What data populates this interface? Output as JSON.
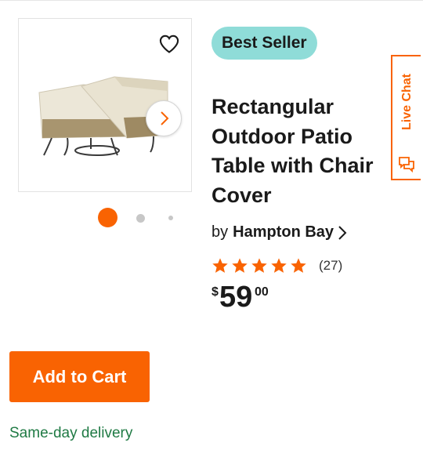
{
  "product": {
    "badge": "Best Seller",
    "title_lines": [
      "Rectangular",
      "Outdoor Patio",
      "Table with Chair",
      "Cover"
    ],
    "brand_prefix": "by",
    "brand": "Hampton Bay",
    "rating": 5,
    "review_count": "(27)",
    "price": {
      "currency": "$",
      "dollars": "59",
      "cents": "00"
    }
  },
  "gallery": {
    "image_count": 3,
    "active_index": 0
  },
  "actions": {
    "add_to_cart": "Add to Cart"
  },
  "delivery": "Same-day delivery",
  "live_chat": {
    "label": "Live Chat"
  },
  "icons": {
    "favorite": "heart-icon",
    "next": "chevron-right-icon",
    "brand_link": "chevron-right-icon",
    "star": "star-icon",
    "chat": "chat-bubbles-icon"
  },
  "colors": {
    "accent": "#f96302",
    "badge_bg": "#8fdcd8",
    "delivery_text": "#1f7a44"
  }
}
